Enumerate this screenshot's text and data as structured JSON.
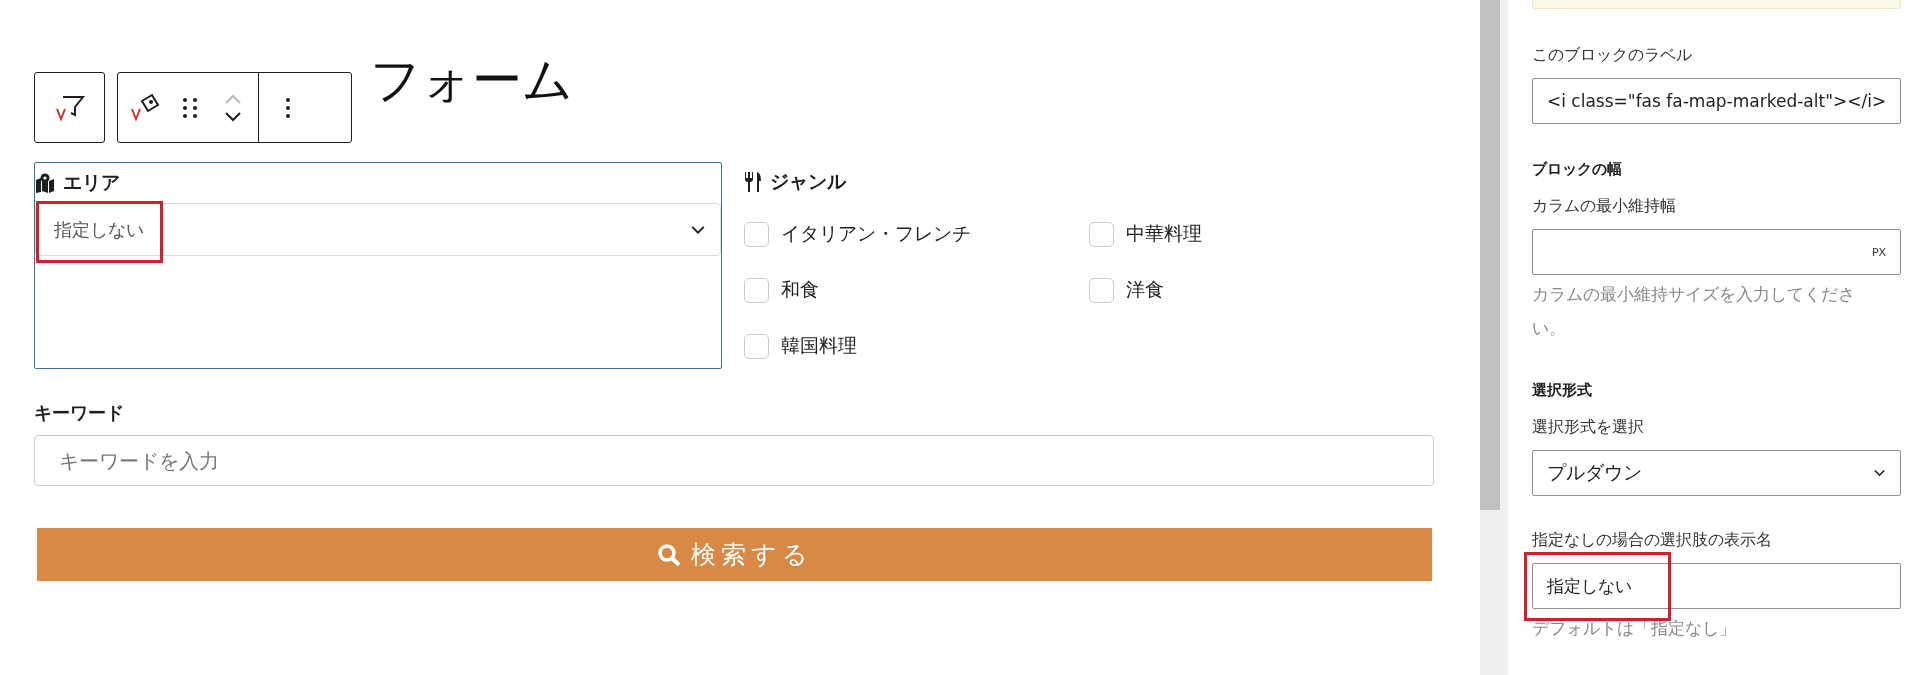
{
  "heading": "フォーム",
  "area": {
    "label": "エリア",
    "value": "指定しない",
    "highlighted": true
  },
  "genre": {
    "label": "ジャンル",
    "options": [
      {
        "label": "イタリアン・フレンチ",
        "checked": false
      },
      {
        "label": "中華料理",
        "checked": false
      },
      {
        "label": "和食",
        "checked": false
      },
      {
        "label": "洋食",
        "checked": false
      },
      {
        "label": "韓国料理",
        "checked": false
      }
    ]
  },
  "keyword": {
    "label": "キーワード",
    "placeholder": "キーワードを入力"
  },
  "search_button": "検索する",
  "sidebar": {
    "sections": [
      {
        "fields": [
          {
            "kind": "text",
            "label": "このブロックのラベル",
            "value": "<i class=\"fas fa-map-marked-alt\"></i>"
          }
        ]
      },
      {
        "title": "ブロックの幅",
        "fields": [
          {
            "kind": "unit",
            "label": "カラムの最小維持幅",
            "unit": "PX",
            "help": "カラムの最小維持サイズを入力してください。"
          }
        ]
      },
      {
        "title": "選択形式",
        "fields": [
          {
            "kind": "select",
            "label": "選択形式を選択",
            "value": "プルダウン"
          },
          {
            "kind": "text",
            "label": "指定なしの場合の選択肢の表示名",
            "value": "指定しない",
            "help": "デフォルトは「指定なし」",
            "highlighted": true
          }
        ]
      }
    ]
  }
}
